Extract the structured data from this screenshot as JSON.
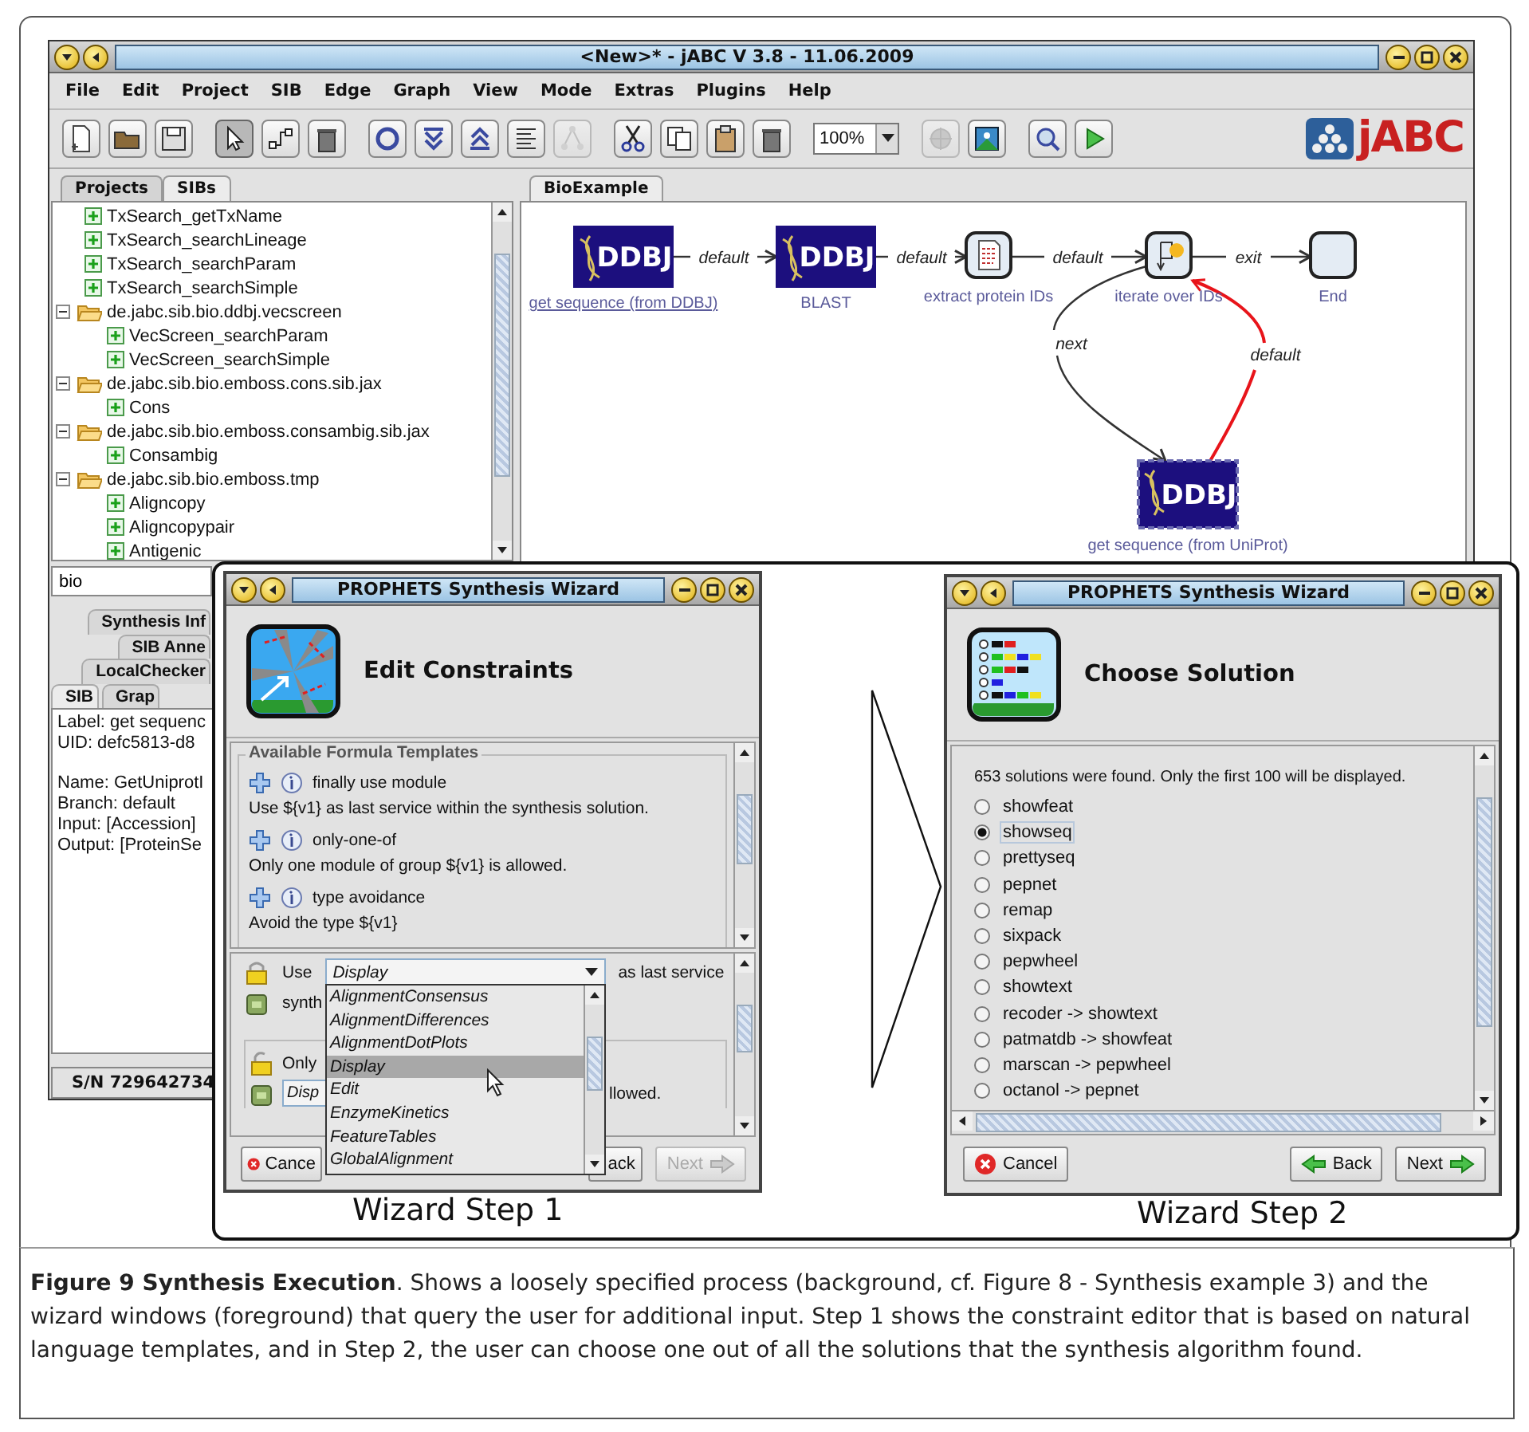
{
  "window": {
    "title": "<New>* - jABC  V 3.8 - 11.06.2009"
  },
  "menu": [
    "File",
    "Edit",
    "Project",
    "SIB",
    "Edge",
    "Graph",
    "View",
    "Mode",
    "Extras",
    "Plugins",
    "Help"
  ],
  "toolbar": {
    "tools": [
      {
        "selected": false,
        "disabled": false
      },
      {
        "selected": false,
        "disabled": false
      },
      {
        "selected": false,
        "disabled": false
      },
      {
        "selected": true,
        "disabled": false
      },
      {
        "selected": false,
        "disabled": false
      },
      {
        "selected": false,
        "disabled": false
      },
      {
        "selected": false,
        "disabled": false
      },
      {
        "selected": false,
        "disabled": false
      },
      {
        "selected": false,
        "disabled": false
      },
      {
        "selected": false,
        "disabled": false
      },
      {
        "selected": false,
        "disabled": true
      },
      {
        "selected": false,
        "disabled": false
      },
      {
        "selected": false,
        "disabled": false
      },
      {
        "selected": false,
        "disabled": false
      },
      {
        "selected": false,
        "disabled": false
      },
      {
        "selected": false,
        "disabled": true
      },
      {
        "selected": false,
        "disabled": false
      },
      {
        "selected": false,
        "disabled": false
      },
      {
        "selected": false,
        "disabled": false
      }
    ],
    "zoom": "100%",
    "logo": "jABC"
  },
  "left_tabs": [
    {
      "label": "Projects",
      "selected": false
    },
    {
      "label": "SIBs",
      "selected": true
    }
  ],
  "tree": [
    {
      "kind": "sib",
      "label": "TxSearch_getTxName"
    },
    {
      "kind": "sib",
      "label": "TxSearch_searchLineage"
    },
    {
      "kind": "sib",
      "label": "TxSearch_searchParam"
    },
    {
      "kind": "sib",
      "label": "TxSearch_searchSimple"
    },
    {
      "kind": "folder",
      "label": "de.jabc.sib.bio.ddbj.vecscreen",
      "expanded": true,
      "children": [
        {
          "kind": "sib",
          "label": "VecScreen_searchParam"
        },
        {
          "kind": "sib",
          "label": "VecScreen_searchSimple"
        }
      ]
    },
    {
      "kind": "folder",
      "label": "de.jabc.sib.bio.emboss.cons.sib.jax",
      "expanded": true,
      "children": [
        {
          "kind": "sib",
          "label": "Cons"
        }
      ]
    },
    {
      "kind": "folder",
      "label": "de.jabc.sib.bio.emboss.consambig.sib.jax",
      "expanded": true,
      "children": [
        {
          "kind": "sib",
          "label": "Consambig"
        }
      ]
    },
    {
      "kind": "folder",
      "label": "de.jabc.sib.bio.emboss.tmp",
      "expanded": true,
      "children": [
        {
          "kind": "sib",
          "label": "Aligncopy"
        },
        {
          "kind": "sib",
          "label": "Aligncopypair"
        },
        {
          "kind": "sib",
          "label": "Antigenic"
        }
      ]
    }
  ],
  "search": {
    "value": "bio"
  },
  "info_tabs": [
    [
      {
        "label": "Synthesis Inf",
        "selected": false
      }
    ],
    [
      {
        "label": "SIB Anne",
        "selected": false
      }
    ],
    [
      {
        "label": "LocalChecker",
        "selected": false
      }
    ],
    [
      {
        "label": "SIB",
        "selected": true
      },
      {
        "label": "Grap",
        "selected": false
      }
    ]
  ],
  "info_groups": [
    [
      "Label: get sequenc",
      "UID: defc5813-d8"
    ],
    [
      "Name: GetUniprotI",
      "Branch: default",
      "Input: [Accession]",
      "Output: [ProteinSe"
    ]
  ],
  "status_bar": "S/N 729642734",
  "editor_tab": {
    "label": "BioExample",
    "selected": true
  },
  "graph": {
    "nodes": [
      {
        "kind": "ddbj",
        "text": "DDBJ",
        "label": "get sequence (from DDBJ)",
        "selected": false,
        "highlighted": true
      },
      {
        "kind": "ddbj",
        "text": "DDBJ",
        "label": "BLAST",
        "selected": false,
        "highlighted": false
      },
      {
        "kind": "extract",
        "label": "extract protein IDs",
        "selected": false,
        "highlighted": false
      },
      {
        "kind": "iterate",
        "label": "iterate over IDs",
        "selected": false,
        "highlighted": false
      },
      {
        "kind": "end",
        "label": "End",
        "selected": false,
        "highlighted": false
      },
      {
        "kind": "ddbj",
        "text": "DDBJ",
        "label": "get sequence (from UniProt)",
        "selected": true,
        "highlighted": false
      }
    ],
    "edges": [
      {
        "label": "default",
        "color": "#333333"
      },
      {
        "label": "default",
        "color": "#333333"
      },
      {
        "label": "default",
        "color": "#333333"
      },
      {
        "label": "exit",
        "color": "#333333"
      },
      {
        "label": "next",
        "color": "#333333"
      },
      {
        "label": "default",
        "color": "#e8141a"
      }
    ]
  },
  "wizard1": {
    "title": "PROPHETS Synthesis Wizard",
    "heading": "Edit Constraints",
    "templates_title": "Available Formula Templates",
    "templates": [
      {
        "name": "finally use module",
        "description": "Use ${v1} as last service within the synthesis solution."
      },
      {
        "name": "only-one-of",
        "description": "Only one module of group ${v1} is allowed."
      },
      {
        "name": "type avoidance",
        "description": "Avoid the type ${v1}"
      }
    ],
    "constraint1": {
      "before": "Use",
      "value": "Display",
      "after": "as last service",
      "continuation": "synth"
    },
    "constraint2": {
      "before": "Only",
      "value": "Disp",
      "after": "llowed."
    },
    "dropdown": [
      {
        "label": "AlignmentConsensus",
        "selected": false
      },
      {
        "label": "AlignmentDifferences",
        "selected": false
      },
      {
        "label": "AlignmentDotPlots",
        "selected": false
      },
      {
        "label": "Display",
        "selected": true
      },
      {
        "label": "Edit",
        "selected": false
      },
      {
        "label": "EnzymeKinetics",
        "selected": false
      },
      {
        "label": "FeatureTables",
        "selected": false
      },
      {
        "label": "GlobalAlignment",
        "selected": false
      }
    ],
    "buttons": {
      "cancel": "Cance",
      "back": "ack",
      "next": "Next",
      "next_disabled": true
    },
    "caption": "Wizard Step 1"
  },
  "wizard2": {
    "title": "PROPHETS Synthesis Wizard",
    "heading": "Choose Solution",
    "message": "653 solutions were found. Only the first 100 will be displayed.",
    "solutions": [
      {
        "label": "showfeat",
        "selected": false
      },
      {
        "label": "showseq",
        "selected": true
      },
      {
        "label": "prettyseq",
        "selected": false
      },
      {
        "label": "pepnet",
        "selected": false
      },
      {
        "label": "remap",
        "selected": false
      },
      {
        "label": "sixpack",
        "selected": false
      },
      {
        "label": "pepwheel",
        "selected": false
      },
      {
        "label": "showtext",
        "selected": false
      },
      {
        "label": "recoder -> showtext",
        "selected": false
      },
      {
        "label": "patmatdb -> showfeat",
        "selected": false
      },
      {
        "label": "marscan -> pepwheel",
        "selected": false
      },
      {
        "label": "octanol -> pepnet",
        "selected": false
      }
    ],
    "buttons": {
      "cancel": "Cancel",
      "back": "Back",
      "next": "Next",
      "next_disabled": false
    },
    "caption": "Wizard Step 2"
  },
  "caption": "**Figure 9 Synthesis Execution**. Shows a loosely specified process (background, cf. Figure 8 - Synthesis example 3) and the wizard windows (foreground) that query the user for additional input. Step 1 shows the constraint editor that is based on natural language templates, and in Step 2, the user can choose one out of all the solutions that the synthesis algorithm found."
}
